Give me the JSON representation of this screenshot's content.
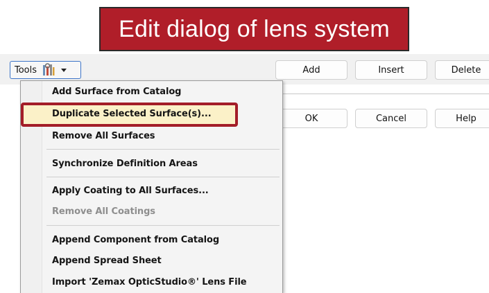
{
  "banner": {
    "title": "Edit dialog of lens system"
  },
  "toolbar": {
    "tools_label": "Tools",
    "add_label": "Add",
    "insert_label": "Insert",
    "delete_label": "Delete",
    "ok_label": "OK",
    "cancel_label": "Cancel",
    "help_label": "Help"
  },
  "menu": {
    "items": [
      {
        "label": "Add Surface from Catalog",
        "enabled": true
      },
      {
        "label": "Duplicate Selected Surface(s)...",
        "enabled": true,
        "highlighted": true
      },
      {
        "label": "Remove All Surfaces",
        "enabled": true
      },
      {
        "label": "Synchronize Definition Areas",
        "enabled": true
      },
      {
        "label": "Apply Coating to All Surfaces...",
        "enabled": true
      },
      {
        "label": "Remove All Coatings",
        "enabled": false
      },
      {
        "label": "Append Component from Catalog",
        "enabled": true
      },
      {
        "label": "Append Spread Sheet",
        "enabled": true
      },
      {
        "label": "Import 'Zemax OpticStudio®' Lens File",
        "enabled": true
      }
    ]
  },
  "icons": {
    "tools": "tools-icon",
    "caret": "chevron-down-icon"
  },
  "colors": {
    "banner": "#b01e29",
    "highlight_border": "#a31d28",
    "highlight_fill": "#fbf1c8"
  }
}
